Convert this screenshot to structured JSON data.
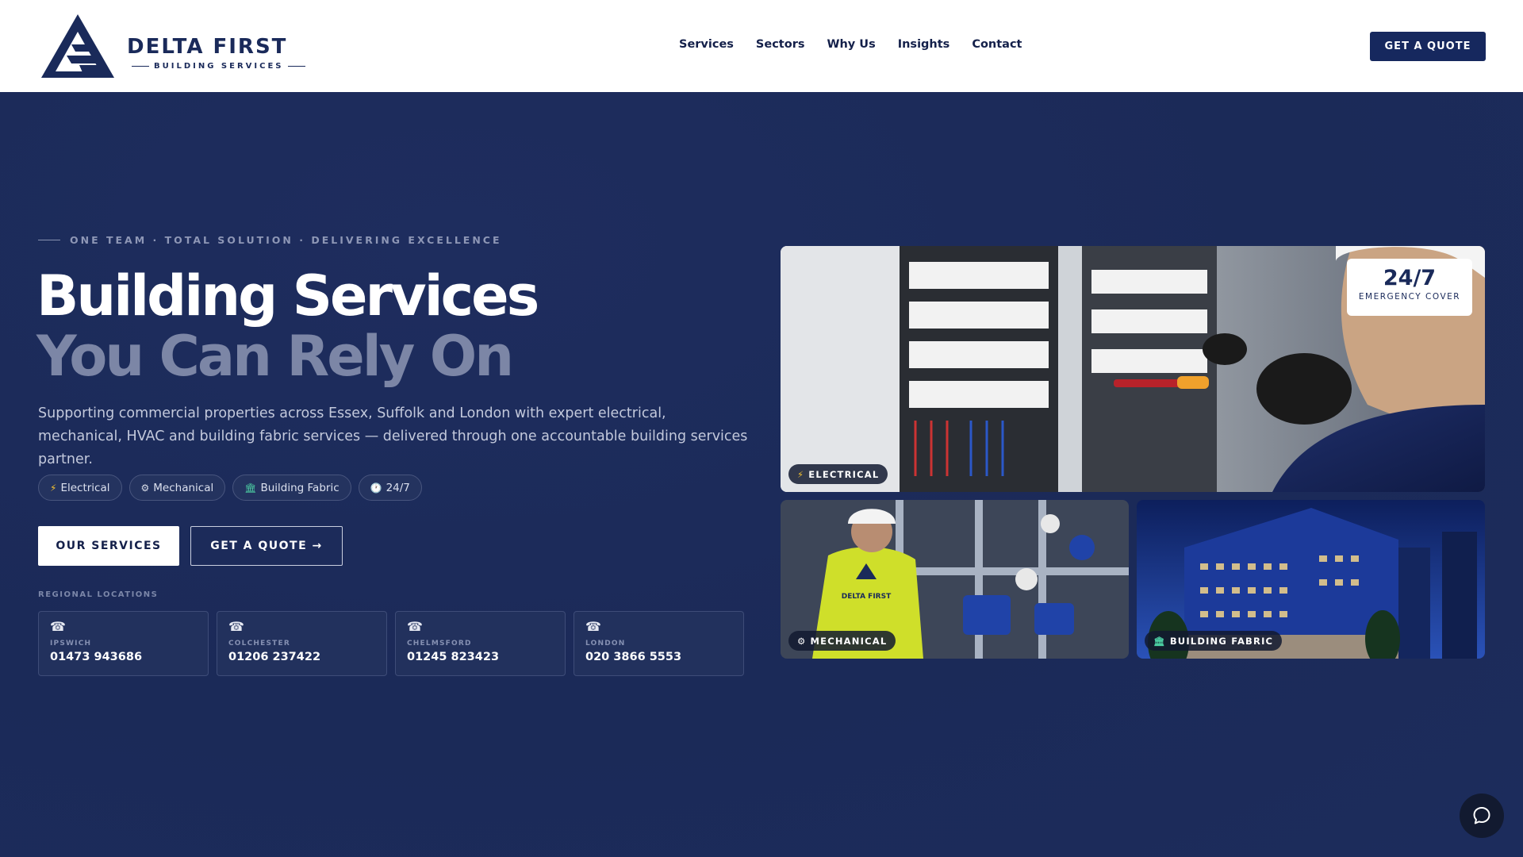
{
  "brand": {
    "name": "DELTA FIRST",
    "tagline": "BUILDING SERVICES"
  },
  "nav": {
    "items": [
      "Services",
      "Sectors",
      "Why Us",
      "Insights",
      "Contact"
    ],
    "cta_label": "GET A QUOTE"
  },
  "hero": {
    "eyebrow": "ONE TEAM · TOTAL SOLUTION · DELIVERING EXCELLENCE",
    "title_line1": "Building Services",
    "title_line2": "You Can Rely On",
    "lede": "Supporting commercial properties across Essex, Suffolk and London with expert electrical, mechanical, HVAC and building fabric services — delivered through one accountable building services partner.",
    "chips": [
      {
        "icon": "bolt-icon",
        "glyph": "⚡",
        "label": "Electrical"
      },
      {
        "icon": "gear-icon",
        "glyph": "⚙",
        "label": "Mechanical"
      },
      {
        "icon": "building-icon",
        "glyph": "🏛",
        "label": "Building Fabric"
      },
      {
        "icon": "clock-icon",
        "glyph": "🕐",
        "label": "24/7"
      }
    ],
    "primary_button": "OUR SERVICES",
    "secondary_button": "GET A QUOTE →",
    "locations_label": "REGIONAL LOCATIONS",
    "locations": [
      {
        "icon": "phone-icon",
        "glyph": "☎",
        "city": "IPSWICH",
        "phone": "01473 943686"
      },
      {
        "icon": "phone-icon",
        "glyph": "☎",
        "city": "COLCHESTER",
        "phone": "01206 237422"
      },
      {
        "icon": "phone-icon",
        "glyph": "☎",
        "city": "CHELMSFORD",
        "phone": "01245 823423"
      },
      {
        "icon": "phone-icon",
        "glyph": "☎",
        "city": "LONDON",
        "phone": "020 3866 5553"
      }
    ]
  },
  "gallery": {
    "main": {
      "badge_glyph": "⚡",
      "badge_label": "ELECTRICAL",
      "cover_title": "24/7",
      "cover_subtitle": "EMERGENCY COVER"
    },
    "mechanical": {
      "badge_glyph": "⚙",
      "badge_label": "MECHANICAL",
      "vest_text": "DELTA FIRST"
    },
    "fabric": {
      "badge_glyph": "🏛",
      "badge_label": "BUILDING FABRIC"
    }
  },
  "colors": {
    "navy": "#1b2a58",
    "button_navy": "#16285e",
    "muted_title": "#7c86a6",
    "accent_yellow": "#f5c330",
    "accent_green": "#4ccfa3"
  }
}
